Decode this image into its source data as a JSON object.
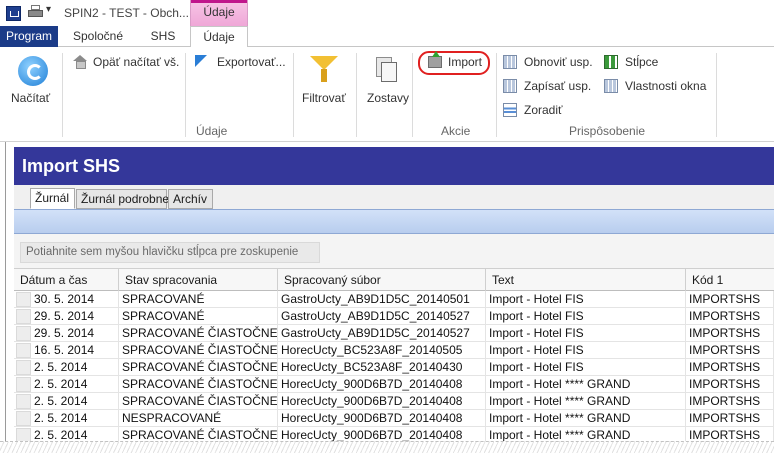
{
  "window": {
    "title": "SPIN2 - TEST - Obch...",
    "context_tab_header": "Údaje"
  },
  "ribbon_tabs": [
    "Program",
    "Spoločné",
    "SHS",
    "Údaje"
  ],
  "ribbon": {
    "nacitat": "Načítať",
    "opat_nacitat": "Opäť načítať vš.",
    "exportovat": "Exportovať...",
    "filtrovat": "Filtrovať",
    "zostavy": "Zostavy",
    "import": "Import",
    "obnovit_usp": "Obnoviť usp.",
    "zapisat_usp": "Zapísať usp.",
    "zoradit": "Zoradiť",
    "stlpce": "Stĺpce",
    "vlastnosti_okna": "Vlastnosti okna",
    "groups": {
      "udaje": "Údaje",
      "akcie": "Akcie",
      "prisposobenie": "Prispôsobenie"
    }
  },
  "panel": {
    "title": "Import SHS",
    "tabs": [
      "Žurnál",
      "Žurnál podrobne",
      "Archív"
    ],
    "group_hint": "Potiahnite sem myšou hlavičku stĺpca pre zoskupenie"
  },
  "grid": {
    "columns": [
      "Dátum a čas",
      "Stav spracovania",
      "Spracovaný súbor",
      "Text",
      "Kód 1"
    ],
    "rows": [
      [
        "30. 5. 2014",
        "SPRACOVANÉ",
        "GastroUcty_AB9D1D5C_20140501",
        "Import - Hotel FIS",
        "IMPORTSHS"
      ],
      [
        "29. 5. 2014",
        "SPRACOVANÉ",
        "GastroUcty_AB9D1D5C_20140527",
        "Import - Hotel FIS",
        "IMPORTSHS"
      ],
      [
        "29. 5. 2014",
        "SPRACOVANÉ ČIASTOČNE",
        "GastroUcty_AB9D1D5C_20140527",
        "Import - Hotel FIS",
        "IMPORTSHS"
      ],
      [
        "16. 5. 2014",
        "SPRACOVANÉ ČIASTOČNE",
        "HorecUcty_BC523A8F_20140505",
        "Import - Hotel FIS",
        "IMPORTSHS"
      ],
      [
        "2. 5. 2014",
        "SPRACOVANÉ ČIASTOČNE",
        "HorecUcty_BC523A8F_20140430",
        "Import - Hotel FIS",
        "IMPORTSHS"
      ],
      [
        "2. 5. 2014",
        "SPRACOVANÉ ČIASTOČNE",
        "HorecUcty_900D6B7D_20140408",
        "Import - Hotel **** GRAND",
        "IMPORTSHS"
      ],
      [
        "2. 5. 2014",
        "SPRACOVANÉ ČIASTOČNE",
        "HorecUcty_900D6B7D_20140408",
        "Import - Hotel **** GRAND",
        "IMPORTSHS"
      ],
      [
        "2. 5. 2014",
        "NESPRACOVANÉ",
        "HorecUcty_900D6B7D_20140408",
        "Import - Hotel **** GRAND",
        "IMPORTSHS"
      ],
      [
        "2. 5. 2014",
        "SPRACOVANÉ ČIASTOČNE",
        "HorecUcty_900D6B7D_20140408",
        "Import - Hotel **** GRAND",
        "IMPORTSHS"
      ]
    ]
  }
}
